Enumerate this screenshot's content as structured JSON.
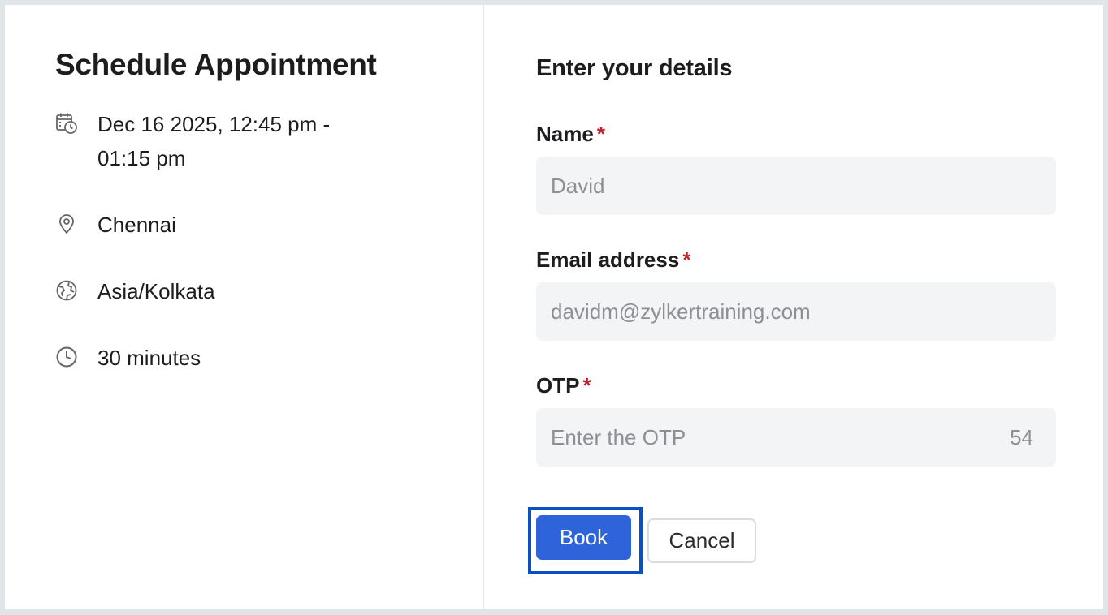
{
  "appointment": {
    "title": "Schedule Appointment",
    "details": [
      {
        "icon": "calendar-clock-icon",
        "text": "Dec 16 2025, 12:45 pm - 01:15 pm"
      },
      {
        "icon": "location-pin-icon",
        "text": "Chennai"
      },
      {
        "icon": "globe-icon",
        "text": "Asia/Kolkata"
      },
      {
        "icon": "clock-icon",
        "text": "30 minutes"
      }
    ]
  },
  "form": {
    "title": "Enter your details",
    "required_mark": "*",
    "name": {
      "label": "Name",
      "value": "David"
    },
    "email": {
      "label": "Email address",
      "value": "davidm@zylkertraining.com"
    },
    "otp": {
      "label": "OTP",
      "placeholder": "Enter the OTP",
      "timer": "54"
    },
    "book_label": "Book",
    "cancel_label": "Cancel"
  },
  "colors": {
    "primary": "#2e63d9",
    "focus_ring": "#0b4fc4",
    "required": "#c0202a",
    "input_bg": "#f3f4f6"
  }
}
